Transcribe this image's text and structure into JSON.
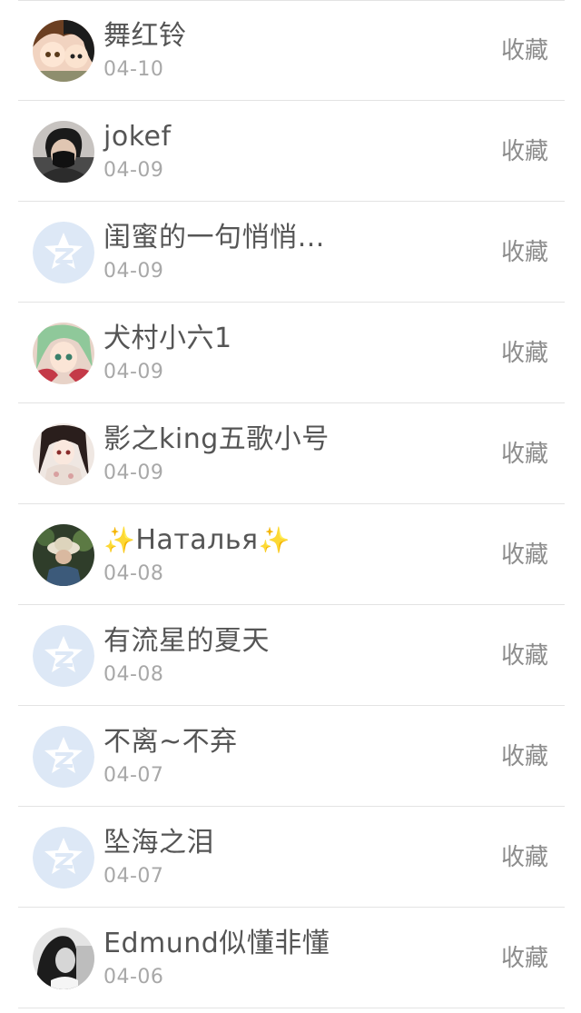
{
  "list": {
    "items": [
      {
        "name": "舞红铃",
        "date": "04-10",
        "action": "收藏",
        "avatar": "anime-girls-avatar"
      },
      {
        "name": "jokef",
        "date": "04-09",
        "action": "收藏",
        "avatar": "masked-man-avatar"
      },
      {
        "name": "闺蜜的一句悄悄…",
        "date": "04-09",
        "action": "收藏",
        "avatar": "default-qzone-avatar"
      },
      {
        "name": "犬村小六1",
        "date": "04-09",
        "action": "收藏",
        "avatar": "anime-green-hair-avatar"
      },
      {
        "name": "影之king五歌小号",
        "date": "04-09",
        "action": "收藏",
        "avatar": "anime-dark-hair-avatar"
      },
      {
        "name": "Наталья",
        "date": "04-08",
        "action": "收藏",
        "avatar": "hat-photo-avatar",
        "decoration": "✨"
      },
      {
        "name": "有流星的夏天",
        "date": "04-08",
        "action": "收藏",
        "avatar": "default-qzone-avatar"
      },
      {
        "name": "不离~不弃",
        "date": "04-07",
        "action": "收藏",
        "avatar": "default-qzone-avatar"
      },
      {
        "name": "坠海之泪",
        "date": "04-07",
        "action": "收藏",
        "avatar": "default-qzone-avatar"
      },
      {
        "name": "Edmund似懂非懂",
        "date": "04-06",
        "action": "收藏",
        "avatar": "bw-girl-avatar"
      }
    ]
  },
  "colors": {
    "name_text": "#555555",
    "date_text": "#a8a8a8",
    "action_text": "#8c8c8c",
    "divider": "#e3e3e3",
    "default_avatar": "#dde8f6"
  }
}
